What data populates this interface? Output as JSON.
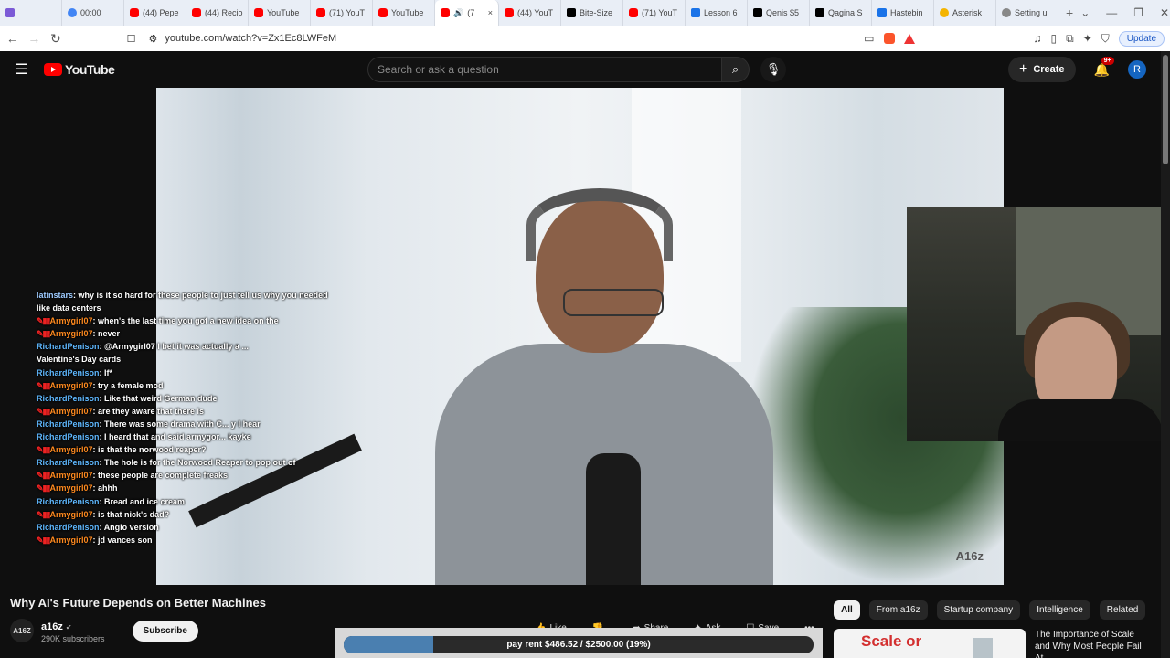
{
  "browser": {
    "tabs": [
      {
        "label": "",
        "icon": "purple"
      },
      {
        "label": "00:00",
        "icon": "g"
      },
      {
        "label": "(44) Pepe",
        "icon": "yt"
      },
      {
        "label": "(44) Recio",
        "icon": "yt"
      },
      {
        "label": "YouTube",
        "icon": "yt"
      },
      {
        "label": "(71) YouT",
        "icon": "yt"
      },
      {
        "label": "YouTube",
        "icon": "yt"
      },
      {
        "label": "(7",
        "icon": "yt",
        "active": true
      },
      {
        "label": "(44) YouT",
        "icon": "yt"
      },
      {
        "label": "Bite-Size",
        "icon": "x"
      },
      {
        "label": "(71) YouT",
        "icon": "yt"
      },
      {
        "label": "Lesson 6",
        "icon": "doc"
      },
      {
        "label": "Qenis $5",
        "icon": "x"
      },
      {
        "label": "Qagina S",
        "icon": "x"
      },
      {
        "label": "Hastebin",
        "icon": "doc"
      },
      {
        "label": "Asterisk",
        "icon": "ast"
      },
      {
        "label": "Setting u",
        "icon": "gear"
      }
    ],
    "new_tab": "+",
    "url": "youtube.com/watch?v=Zx1Ec8LWFeM",
    "update_label": "Update"
  },
  "header": {
    "logo_text": "YouTube",
    "search_placeholder": "Search or ask a question",
    "create_label": "Create",
    "notif_badge": "9+",
    "avatar_letter": "R"
  },
  "video": {
    "watermark": "A16z"
  },
  "chat": [
    {
      "user": "latinstars",
      "kind": "c",
      "badges": false,
      "msg": "why is it so hard for these people to just tell us why you needed"
    },
    {
      "user": "",
      "kind": "",
      "badges": false,
      "msg": "like data centers"
    },
    {
      "user": "Armygirl07",
      "kind": "a",
      "badges": true,
      "msg": "when's the last time you got a new idea on the"
    },
    {
      "user": "Armygirl07",
      "kind": "a",
      "badges": true,
      "msg": "never"
    },
    {
      "user": "RichardPenison",
      "kind": "b",
      "badges": false,
      "msg": "@Armygirl07 I bet it was actually a ..."
    },
    {
      "user": "",
      "kind": "",
      "badges": false,
      "msg": "Valentine's Day cards"
    },
    {
      "user": "RichardPenison",
      "kind": "b",
      "badges": false,
      "msg": "If*"
    },
    {
      "user": "Armygirl07",
      "kind": "a",
      "badges": true,
      "msg": "try a female mod"
    },
    {
      "user": "RichardPenison",
      "kind": "b",
      "badges": false,
      "msg": "Like that weird German dude"
    },
    {
      "user": "Armygirl07",
      "kind": "a",
      "badges": true,
      "msg": "are they aware that there is"
    },
    {
      "user": "RichardPenison",
      "kind": "b",
      "badges": false,
      "msg": "There was some drama with C... y I hear"
    },
    {
      "user": "RichardPenison",
      "kind": "b",
      "badges": false,
      "msg": "I heard that and said armygor... kayke"
    },
    {
      "user": "Armygirl07",
      "kind": "a",
      "badges": true,
      "msg": "is that the norwood reaper?"
    },
    {
      "user": "RichardPenison",
      "kind": "b",
      "badges": false,
      "msg": "The hole is for the Norwood Reaper to pop out of"
    },
    {
      "user": "Armygirl07",
      "kind": "a",
      "badges": true,
      "msg": "these people are complete freaks"
    },
    {
      "user": "Armygirl07",
      "kind": "a",
      "badges": true,
      "msg": "ahhh"
    },
    {
      "user": "RichardPenison",
      "kind": "b",
      "badges": false,
      "msg": "Bread and ice cream"
    },
    {
      "user": "Armygirl07",
      "kind": "a",
      "badges": true,
      "msg": "is that nick's dad?"
    },
    {
      "user": "RichardPenison",
      "kind": "b",
      "badges": false,
      "msg": "Anglo version"
    },
    {
      "user": "Armygirl07",
      "kind": "a",
      "badges": true,
      "msg": "jd vances son"
    }
  ],
  "below": {
    "title": "Why AI's Future Depends on Better Machines",
    "channel_avatar": "A16Z",
    "channel": "a16z",
    "subscribers": "290K subscribers",
    "subscribe_label": "Subscribe",
    "actions": [
      {
        "label": "Like",
        "icon": "like-icon"
      },
      {
        "label": "",
        "icon": "dislike-icon"
      },
      {
        "label": "Share",
        "icon": "share-icon"
      },
      {
        "label": "Ask",
        "icon": "sparkle-icon"
      },
      {
        "label": "Save",
        "icon": "save-icon"
      },
      {
        "label": "•••",
        "icon": "more-icon"
      }
    ]
  },
  "rent": {
    "text": "pay rent $486.52 / $2500.00 (19%)",
    "percent": 19
  },
  "chips": [
    "All",
    "From a16z",
    "Startup company",
    "Intelligence",
    "Related"
  ],
  "recommendation": {
    "thumb_text": "Scale or",
    "title": "The Importance of Scale and Why Most People Fail At"
  }
}
